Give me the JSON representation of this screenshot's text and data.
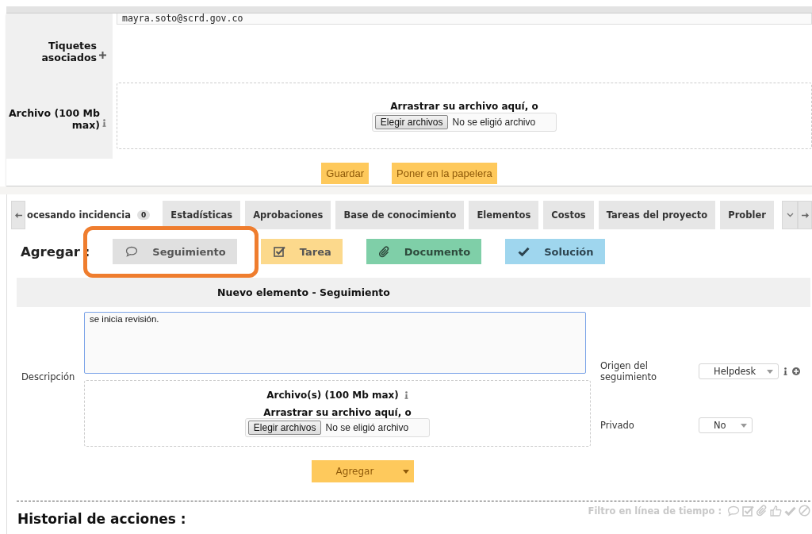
{
  "record": {
    "email": "mayra.soto@scrd.gov.co",
    "fields": [
      {
        "label": "Tiquetes asociados",
        "kind": "add"
      },
      {
        "label": "Archivo (100 Mb max)",
        "kind": "upload",
        "drop_text": "Arrastrar su archivo aquí, o",
        "file_button": "Elegir archivos",
        "file_status": "No se eligió archivo"
      }
    ],
    "buttons": [
      "Guardar",
      "Poner en la papelera"
    ]
  },
  "tabs": [
    {
      "label": "ocesando incidencia",
      "count": "0",
      "selected": true
    },
    {
      "label": "Estadísticas",
      "selected": false
    },
    {
      "label": "Aprobaciones",
      "selected": false
    },
    {
      "label": "Base de conocimiento",
      "selected": false
    },
    {
      "label": "Elementos",
      "selected": false
    },
    {
      "label": "Costos",
      "selected": false
    },
    {
      "label": "Tareas del proyecto",
      "selected": false
    },
    {
      "label": "Probler",
      "selected": false
    }
  ],
  "add_bar": {
    "label": "Agregar :",
    "buttons": [
      {
        "label": "Seguimiento",
        "kind": "followup",
        "selected": true,
        "highlighted": true
      },
      {
        "label": "Tarea",
        "kind": "task",
        "selected": false,
        "highlighted": false
      },
      {
        "label": "Documento",
        "kind": "document",
        "selected": false,
        "highlighted": false
      },
      {
        "label": "Solución",
        "kind": "solution",
        "selected": false,
        "highlighted": false
      }
    ]
  },
  "form": {
    "title": "Nuevo elemento - Seguimiento",
    "description_label": "Descripción",
    "description": "se inicia revisión.",
    "attachments": {
      "title": "Archivo(s) (100 Mb max)",
      "drop_text": "Arrastrar su archivo aquí, o",
      "file_button": "Elegir archivos",
      "file_status": "No se eligió archivo"
    },
    "origin": {
      "label": "Origen del seguimiento",
      "value": "Helpdesk"
    },
    "private": {
      "label": "Privado",
      "value": "No"
    },
    "submit": "Agregar"
  },
  "history": {
    "title": "Historial de acciones :",
    "filter_label": "Filtro en línea de tiempo :"
  }
}
